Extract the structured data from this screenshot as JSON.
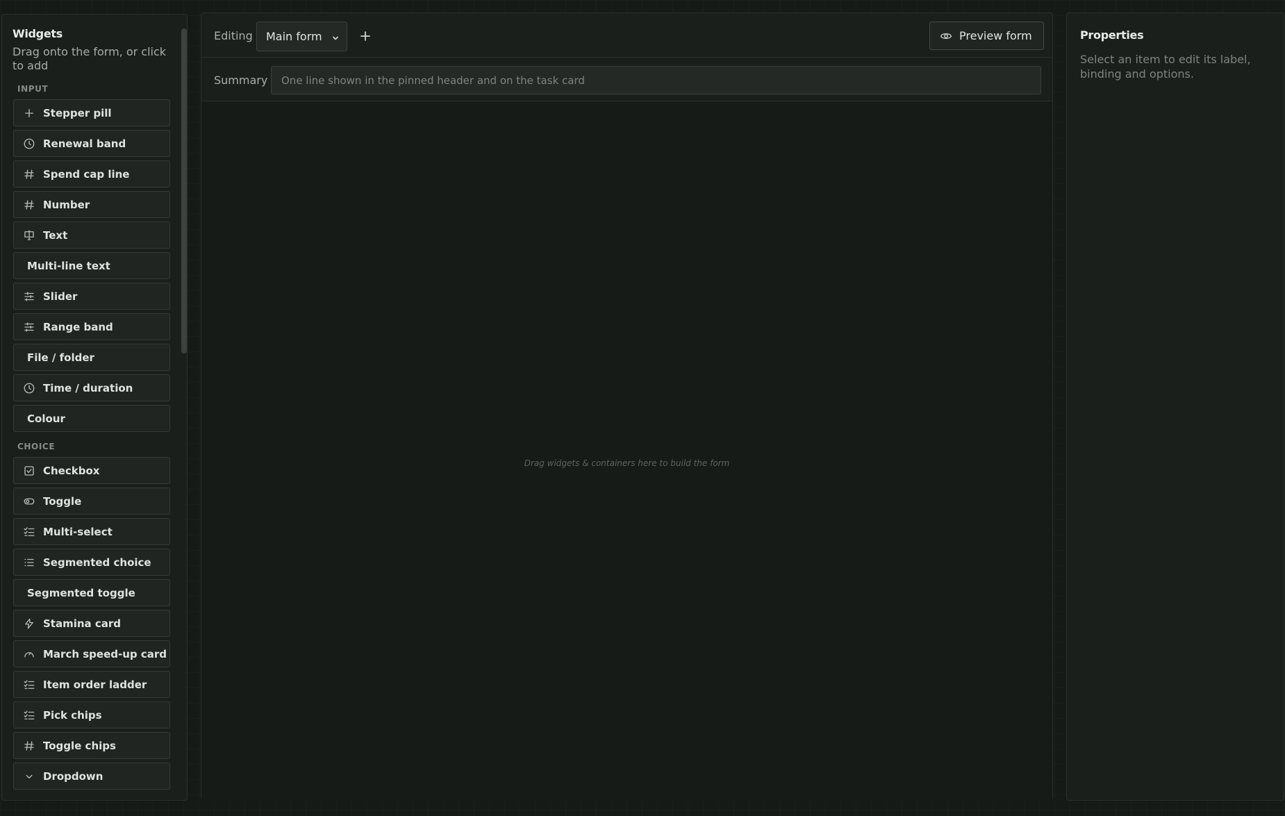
{
  "widgets_panel": {
    "title": "Widgets",
    "subtitle": "Drag onto the form, or click to add",
    "sections": [
      {
        "label": "INPUT",
        "items": [
          {
            "label": "Stepper pill",
            "icon": "plus-icon"
          },
          {
            "label": "Renewal band",
            "icon": "clock-icon"
          },
          {
            "label": "Spend cap line",
            "icon": "hash-icon"
          },
          {
            "label": "Number",
            "icon": "hash-icon"
          },
          {
            "label": "Text",
            "icon": "text-cursor-icon"
          },
          {
            "label": "Multi-line text",
            "icon": ""
          },
          {
            "label": "Slider",
            "icon": "sliders-icon"
          },
          {
            "label": "Range band",
            "icon": "sliders-icon"
          },
          {
            "label": "File / folder",
            "icon": ""
          },
          {
            "label": "Time / duration",
            "icon": "clock-icon"
          },
          {
            "label": "Colour",
            "icon": ""
          }
        ]
      },
      {
        "label": "CHOICE",
        "items": [
          {
            "label": "Checkbox",
            "icon": "checkbox-icon"
          },
          {
            "label": "Toggle",
            "icon": "toggle-icon"
          },
          {
            "label": "Multi-select",
            "icon": "checklist-icon"
          },
          {
            "label": "Segmented choice",
            "icon": "list-icon"
          },
          {
            "label": "Segmented toggle",
            "icon": ""
          },
          {
            "label": "Stamina card",
            "icon": "lightning-icon"
          },
          {
            "label": "March speed-up card",
            "icon": "gauge-icon"
          },
          {
            "label": "Item order ladder",
            "icon": "checklist-icon"
          },
          {
            "label": "Pick chips",
            "icon": "checklist-icon"
          },
          {
            "label": "Toggle chips",
            "icon": "hash-icon"
          },
          {
            "label": "Dropdown",
            "icon": "chevron-down-icon"
          }
        ]
      }
    ]
  },
  "toolbar": {
    "editing_label": "Editing",
    "form_select_value": "Main form",
    "add_form_icon": "plus-icon",
    "preview_label": "Preview form",
    "preview_icon": "eye-icon"
  },
  "summary": {
    "label": "Summary",
    "value": "",
    "placeholder": "One line shown in the pinned header and on the task card"
  },
  "canvas": {
    "hint": "Drag widgets & containers here to build the form"
  },
  "properties": {
    "title": "Properties",
    "hint": "Select an item to edit its label, binding and options."
  },
  "colors": {
    "background": "#161a17",
    "panel": "#1b1f1c",
    "widget_item": "#202521",
    "border": "#353b36"
  }
}
